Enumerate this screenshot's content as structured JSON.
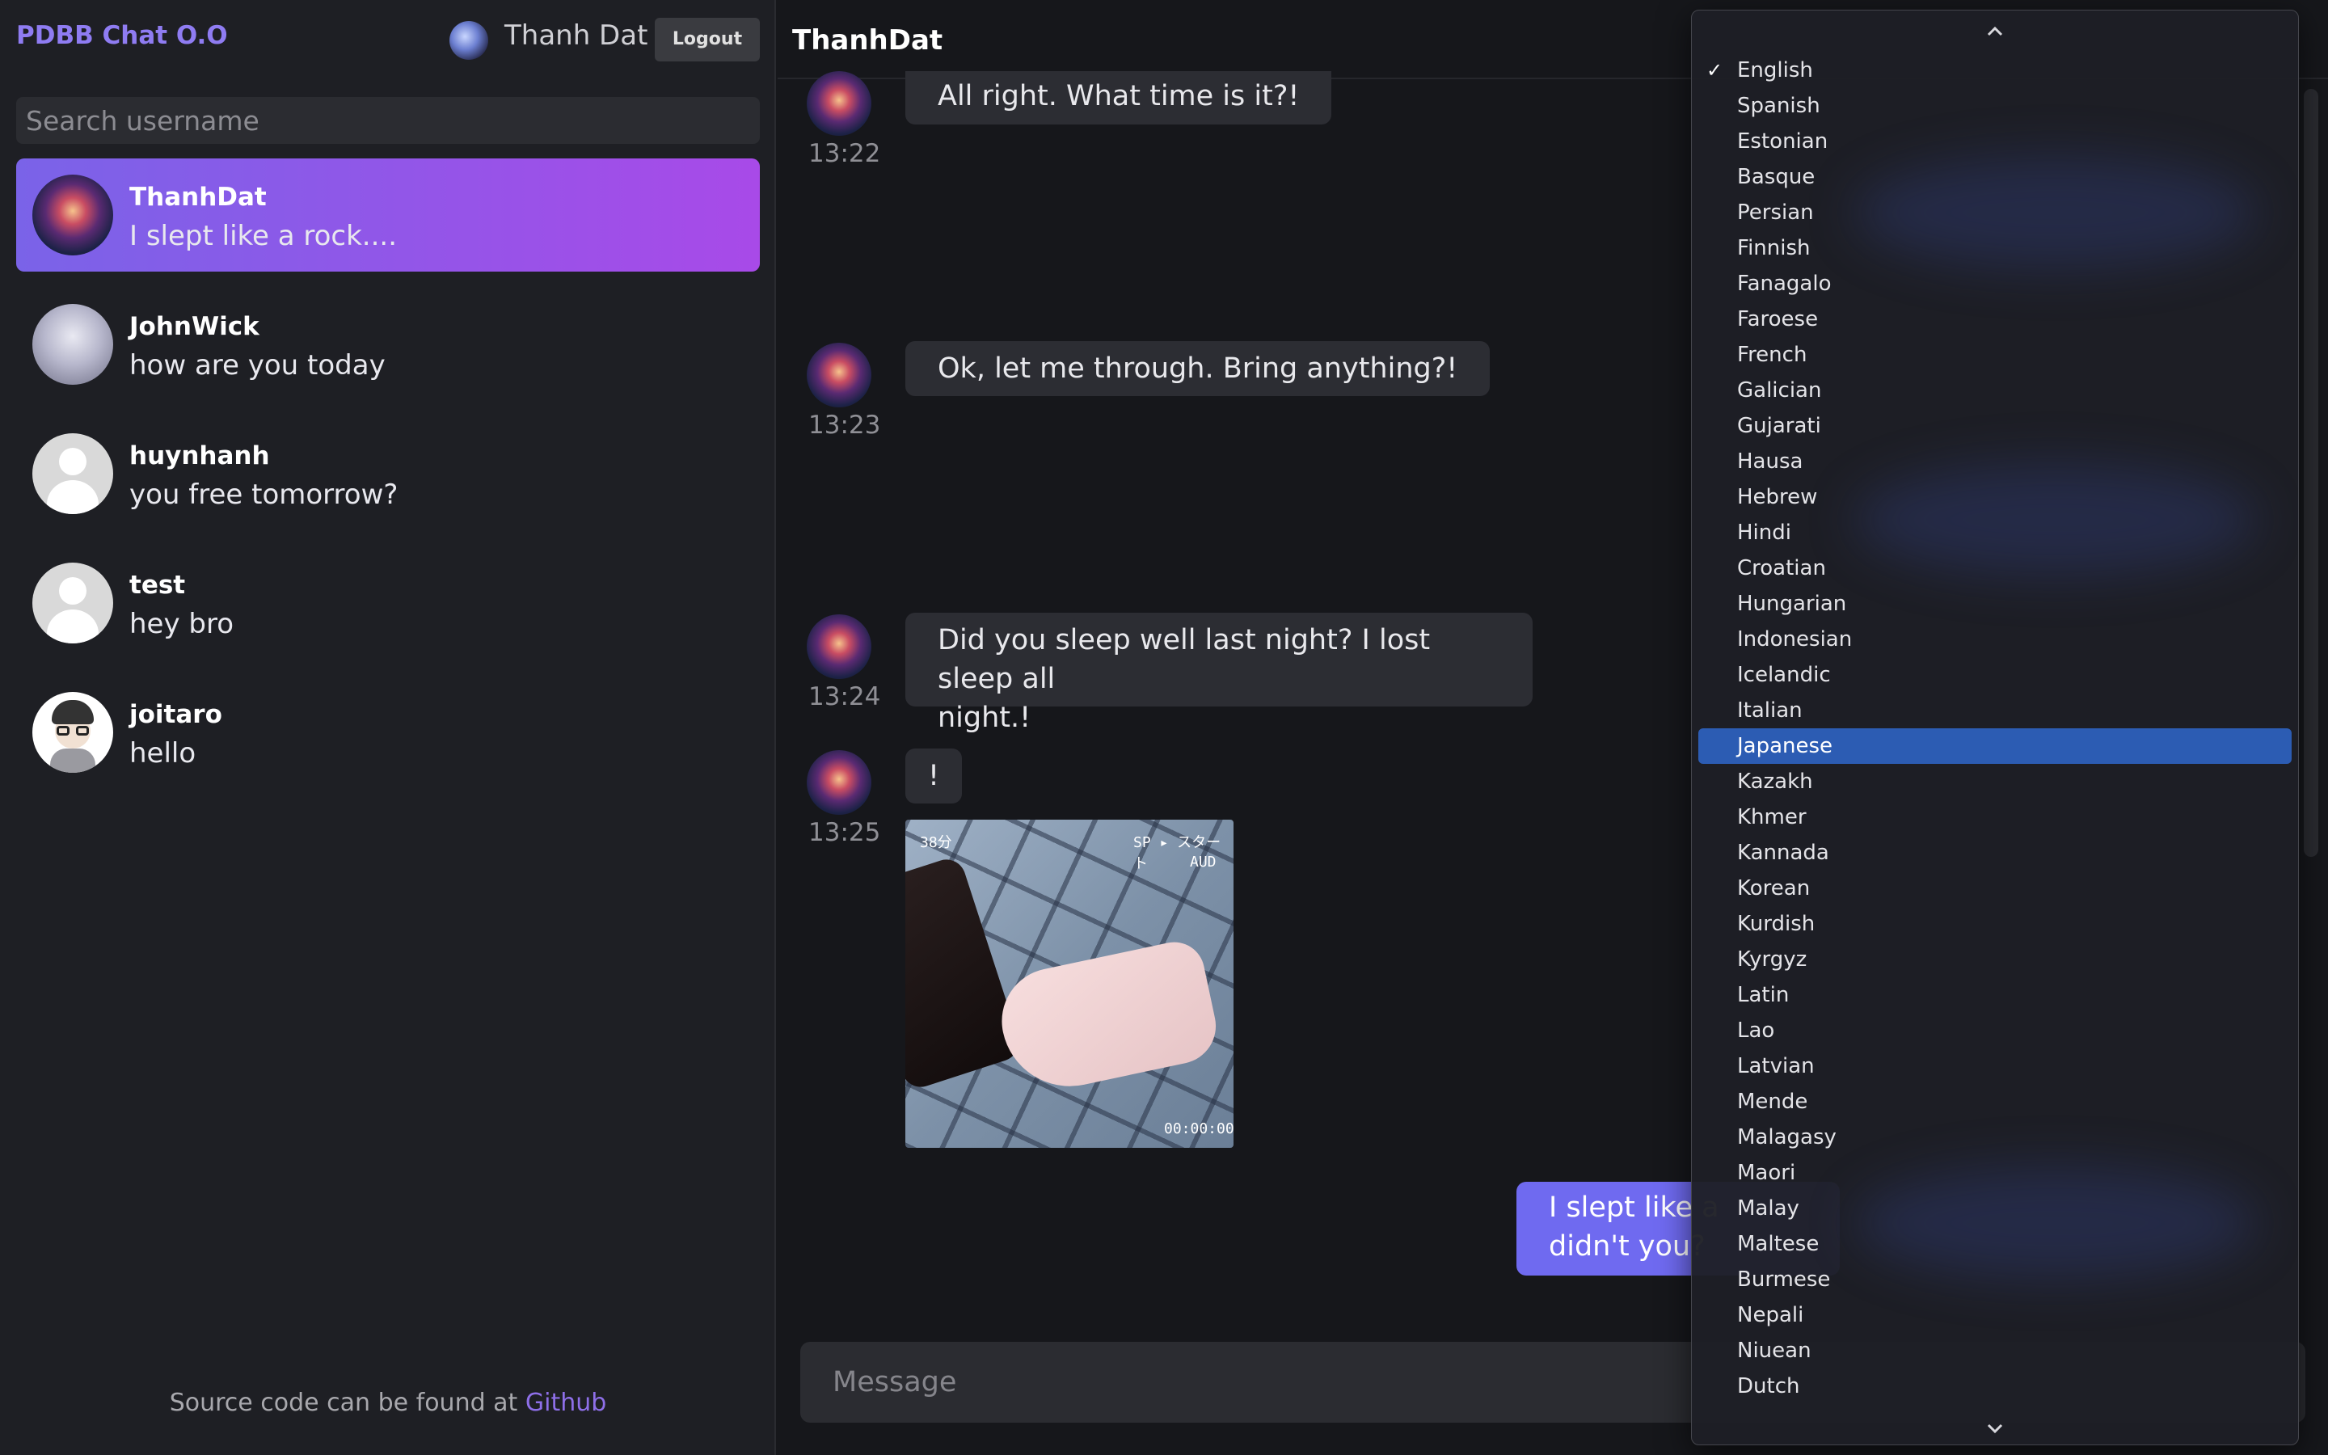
{
  "app": {
    "brand": "PDBB Chat O.O",
    "current_user": "Thanh Dat",
    "logout_label": "Logout"
  },
  "search": {
    "placeholder": "Search username"
  },
  "conversations": [
    {
      "name": "ThanhDat",
      "last_message": "I slept like a rock....",
      "avatar": "galaxy-avatar",
      "active": true
    },
    {
      "name": "JohnWick",
      "last_message": "how are you today",
      "avatar": "anime-avatar",
      "active": false
    },
    {
      "name": "huynhanh",
      "last_message": "you free tomorrow?",
      "avatar": "default-avatar",
      "active": false
    },
    {
      "name": "test",
      "last_message": "hey bro",
      "avatar": "default-avatar",
      "active": false
    },
    {
      "name": "joitaro",
      "last_message": "hello",
      "avatar": "glasses-avatar",
      "active": false
    }
  ],
  "footer": {
    "text": "Source code can be found at ",
    "link_label": "Github"
  },
  "chat": {
    "title": "ThanhDat",
    "messages": [
      {
        "text": "All right. What time is it?!",
        "time": "13:22"
      },
      {
        "text": "Ok, let me through. Bring anything?!",
        "time": "13:23"
      },
      {
        "text_line1": "Did you sleep well last night? I lost sleep all",
        "text_line2": "night.!",
        "time": "13:24"
      },
      {
        "text": "!",
        "time": "13:25"
      }
    ],
    "photo_hud": {
      "top_left": "38分",
      "top_right": "SP ▸ スタート",
      "top_right2": "AUD",
      "bottom_right": "00:00:00"
    },
    "own_message": {
      "line1": "I slept like a",
      "line2": "didn't you?"
    },
    "composer_placeholder": "Message"
  },
  "language_dropdown": {
    "selected": "Japanese",
    "checked": "English",
    "options": [
      "English",
      "Spanish",
      "Estonian",
      "Basque",
      "Persian",
      "Finnish",
      "Fanagalo",
      "Faroese",
      "French",
      "Galician",
      "Gujarati",
      "Hausa",
      "Hebrew",
      "Hindi",
      "Croatian",
      "Hungarian",
      "Indonesian",
      "Icelandic",
      "Italian",
      "Japanese",
      "Kazakh",
      "Khmer",
      "Kannada",
      "Korean",
      "Kurdish",
      "Kyrgyz",
      "Latin",
      "Lao",
      "Latvian",
      "Mende",
      "Malagasy",
      "Maori",
      "Malay",
      "Maltese",
      "Burmese",
      "Nepali",
      "Niuean",
      "Dutch"
    ]
  },
  "colors": {
    "accent": "#8f7cf2",
    "active_gradient_start": "#7a63e8",
    "active_gradient_end": "#a84ae8",
    "own_bubble": "#6f6af0",
    "dropdown_selected": "#2c5cb3"
  }
}
